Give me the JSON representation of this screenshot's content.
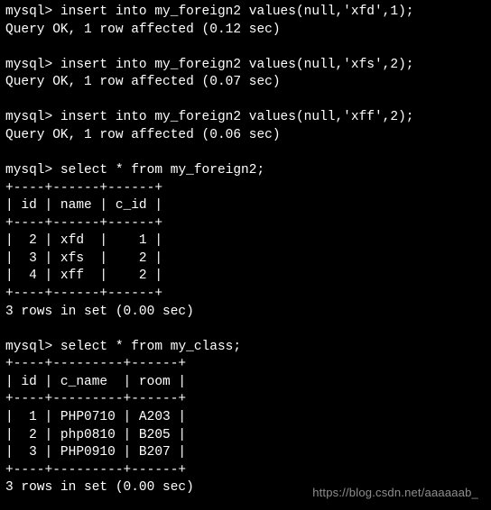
{
  "prompt": "mysql>",
  "commands": {
    "insert1": "insert into my_foreign2 values(null,'xfd',1);",
    "insert1_result": "Query OK, 1 row affected (0.12 sec)",
    "insert2": "insert into my_foreign2 values(null,'xfs',2);",
    "insert2_result": "Query OK, 1 row affected (0.07 sec)",
    "insert3": "insert into my_foreign2 values(null,'xff',2);",
    "insert3_result": "Query OK, 1 row affected (0.06 sec)",
    "select1": "select * from my_foreign2;",
    "select2": "select * from my_class;"
  },
  "tables": {
    "my_foreign2": {
      "border": "+----+------+------+",
      "header": "| id | name | c_id |",
      "rows": [
        "|  2 | xfd  |    1 |",
        "|  3 | xfs  |    2 |",
        "|  4 | xff  |    2 |"
      ],
      "footer": "3 rows in set (0.00 sec)"
    },
    "my_class": {
      "border": "+----+---------+------+",
      "header": "| id | c_name  | room |",
      "rows": [
        "|  1 | PHP0710 | A203 |",
        "|  2 | php0810 | B205 |",
        "|  3 | PHP0910 | B207 |"
      ],
      "footer": "3 rows in set (0.00 sec)"
    }
  },
  "chart_data": [
    {
      "type": "table",
      "title": "my_foreign2",
      "columns": [
        "id",
        "name",
        "c_id"
      ],
      "rows": [
        [
          2,
          "xfd",
          1
        ],
        [
          3,
          "xfs",
          2
        ],
        [
          4,
          "xff",
          2
        ]
      ]
    },
    {
      "type": "table",
      "title": "my_class",
      "columns": [
        "id",
        "c_name",
        "room"
      ],
      "rows": [
        [
          1,
          "PHP0710",
          "A203"
        ],
        [
          2,
          "php0810",
          "B205"
        ],
        [
          3,
          "PHP0910",
          "B207"
        ]
      ]
    }
  ],
  "watermark": "https://blog.csdn.net/aaaaaab_"
}
